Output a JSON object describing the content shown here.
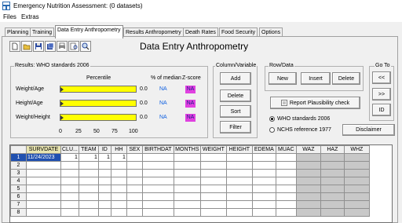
{
  "window": {
    "title": "Emergency Nutrition Assessment:  (0 datasets)",
    "icon": "ena-app-icon"
  },
  "menu": [
    {
      "label": "Files"
    },
    {
      "label": "Extras"
    }
  ],
  "tabs": [
    {
      "label": "Planning",
      "active": false
    },
    {
      "label": "Training",
      "active": false
    },
    {
      "label": "Data Entry Anthropometry",
      "active": true
    },
    {
      "label": "Results Anthropometry",
      "active": false
    },
    {
      "label": "Death Rates",
      "active": false
    },
    {
      "label": "Food Security",
      "active": false
    },
    {
      "label": "Options",
      "active": false
    }
  ],
  "toolbar": {
    "icons": [
      "new-file-icon",
      "open-folder-icon",
      "save-icon",
      "save-as-icon",
      "print-icon",
      "print-preview-icon",
      "zoom-icon"
    ]
  },
  "page_title": "Data Entry Anthropometry",
  "results": {
    "group_label": "Results: WHO standards 2006",
    "col_percentile": "Percentile",
    "col_median": "% of median",
    "col_zscore": "Z-score",
    "rows": [
      {
        "label": "Weight/Age",
        "percent": "0.0",
        "median": "NA",
        "zscore": "NA"
      },
      {
        "label": "Height/Age",
        "percent": "0.0",
        "median": "NA",
        "zscore": "NA"
      },
      {
        "label": "Weight/Height",
        "percent": "0.0",
        "median": "NA",
        "zscore": "NA"
      }
    ],
    "scale": [
      "0",
      "25",
      "50",
      "75",
      "100"
    ],
    "bar_color": "#ffff00",
    "zscore_color": "#e040e0"
  },
  "column_variable": {
    "group_label": "Column/Variable",
    "add": "Add",
    "delete": "Delete",
    "sort": "Sort",
    "filter": "Filter"
  },
  "row_data": {
    "group_label": "Row/Data",
    "new": "New",
    "insert": "Insert",
    "delete": "Delete",
    "plausibility": "Report Plausibility check",
    "radio_who": "WHO standards 2006",
    "radio_nchs": "NCHS reference 1977",
    "who_selected": true,
    "disclaimer": "Disclaimer"
  },
  "goto": {
    "group_label": "Go To",
    "prev": "<<",
    "next": ">>",
    "id": "ID"
  },
  "grid": {
    "columns": [
      "SURVDATE",
      "CLU...",
      "TEAM",
      "ID",
      "HH",
      "SEX",
      "BIRTHDAT",
      "MONTHS",
      "WEIGHT",
      "HEIGHT",
      "EDEMA",
      "MUAC",
      "WAZ",
      "HAZ",
      "WHZ"
    ],
    "rows": [
      [
        "11/24/2023",
        "1",
        "1",
        "1",
        "1",
        "",
        "",
        "",
        "",
        "",
        "",
        "",
        "",
        "",
        ""
      ],
      [
        "",
        "",
        "",
        "",
        "",
        "",
        "",
        "",
        "",
        "",
        "",
        "",
        "",
        "",
        ""
      ],
      [
        "",
        "",
        "",
        "",
        "",
        "",
        "",
        "",
        "",
        "",
        "",
        "",
        "",
        "",
        ""
      ],
      [
        "",
        "",
        "",
        "",
        "",
        "",
        "",
        "",
        "",
        "",
        "",
        "",
        "",
        "",
        ""
      ],
      [
        "",
        "",
        "",
        "",
        "",
        "",
        "",
        "",
        "",
        "",
        "",
        "",
        "",
        "",
        ""
      ],
      [
        "",
        "",
        "",
        "",
        "",
        "",
        "",
        "",
        "",
        "",
        "",
        "",
        "",
        "",
        ""
      ],
      [
        "",
        "",
        "",
        "",
        "",
        "",
        "",
        "",
        "",
        "",
        "",
        "",
        "",
        "",
        ""
      ],
      [
        "",
        "",
        "",
        "",
        "",
        "",
        "",
        "",
        "",
        "",
        "",
        "",
        "",
        "",
        ""
      ]
    ],
    "row_numbers": [
      "1",
      "2",
      "3",
      "4",
      "5",
      "6",
      "7",
      "8"
    ],
    "selection_color": "#2050b0"
  }
}
